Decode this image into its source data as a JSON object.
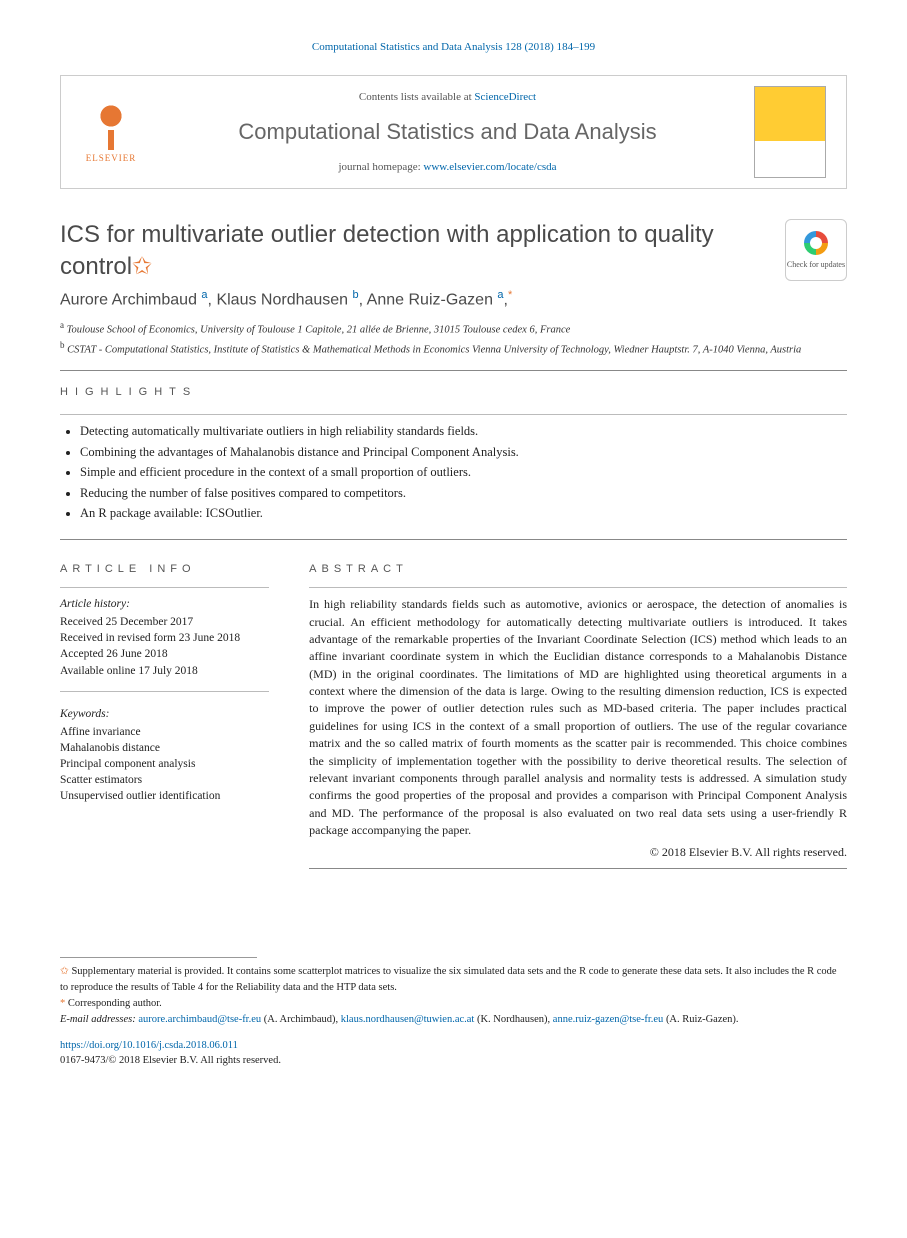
{
  "citation": "Computational Statistics and Data Analysis 128 (2018) 184–199",
  "publisher": {
    "name": "ELSEVIER",
    "contents_prefix": "Contents lists available at ",
    "contents_link": "ScienceDirect",
    "journal_name": "Computational Statistics and Data Analysis",
    "homepage_prefix": "journal homepage: ",
    "homepage_link": "www.elsevier.com/locate/csda"
  },
  "article": {
    "title": "ICS for multivariate outlier detection with application to quality control",
    "check_updates_label": "Check for updates"
  },
  "authors_line": {
    "a1_name": "Aurore Archimbaud",
    "a1_aff": "a",
    "a2_name": "Klaus Nordhausen",
    "a2_aff": "b",
    "a3_name": "Anne Ruiz-Gazen",
    "a3_aff": "a"
  },
  "affiliations": {
    "a": "Toulouse School of Economics, University of Toulouse 1 Capitole, 21 allée de Brienne, 31015 Toulouse cedex 6, France",
    "b": "CSTAT - Computational Statistics, Institute of Statistics & Mathematical Methods in Economics Vienna University of Technology, Wiedner Hauptstr. 7, A-1040 Vienna, Austria"
  },
  "highlights": {
    "heading": "highlights",
    "items": [
      "Detecting automatically multivariate outliers in high reliability standards fields.",
      "Combining the advantages of Mahalanobis distance and Principal Component Analysis.",
      "Simple and efficient procedure in the context of a small proportion of outliers.",
      "Reducing the number of false positives compared to competitors.",
      "An R package available: ICSOutlier."
    ]
  },
  "article_info": {
    "heading": "article info",
    "history_label": "Article history:",
    "history": [
      "Received 25 December 2017",
      "Received in revised form 23 June 2018",
      "Accepted 26 June 2018",
      "Available online 17 July 2018"
    ],
    "keywords_label": "Keywords:",
    "keywords": [
      "Affine invariance",
      "Mahalanobis distance",
      "Principal component analysis",
      "Scatter estimators",
      "Unsupervised outlier identification"
    ]
  },
  "abstract": {
    "heading": "abstract",
    "body": "In high reliability standards fields such as automotive, avionics or aerospace, the detection of anomalies is crucial. An efficient methodology for automatically detecting multivariate outliers is introduced. It takes advantage of the remarkable properties of the Invariant Coordinate Selection (ICS) method which leads to an affine invariant coordinate system in which the Euclidian distance corresponds to a Mahalanobis Distance (MD) in the original coordinates. The limitations of MD are highlighted using theoretical arguments in a context where the dimension of the data is large. Owing to the resulting dimension reduction, ICS is expected to improve the power of outlier detection rules such as MD-based criteria. The paper includes practical guidelines for using ICS in the context of a small proportion of outliers. The use of the regular covariance matrix and the so called matrix of fourth moments as the scatter pair is recommended. This choice combines the simplicity of implementation together with the possibility to derive theoretical results. The selection of relevant invariant components through parallel analysis and normality tests is addressed. A simulation study confirms the good properties of the proposal and provides a comparison with Principal Component Analysis and MD. The performance of the proposal is also evaluated on two real data sets using a user-friendly R package accompanying the paper.",
    "copyright": "© 2018 Elsevier B.V. All rights reserved."
  },
  "footnotes": {
    "supp": "Supplementary material is provided. It contains some scatterplot matrices to visualize the six simulated data sets and the R code to generate these data sets. It also includes the R code to reproduce the results of Table 4 for the Reliability data and the HTP data sets.",
    "corr_label": "Corresponding author.",
    "email_label": "E-mail addresses:",
    "email1": "aurore.archimbaud@tse-fr.eu",
    "email1_who": "(A. Archimbaud)",
    "email2": "klaus.nordhausen@tuwien.ac.at",
    "email2_who": "(K. Nordhausen)",
    "email3": "anne.ruiz-gazen@tse-fr.eu",
    "email3_who": "(A. Ruiz-Gazen)"
  },
  "doi": {
    "link": "https://doi.org/10.1016/j.csda.2018.06.011",
    "issn_line": "0167-9473/© 2018 Elsevier B.V. All rights reserved."
  }
}
